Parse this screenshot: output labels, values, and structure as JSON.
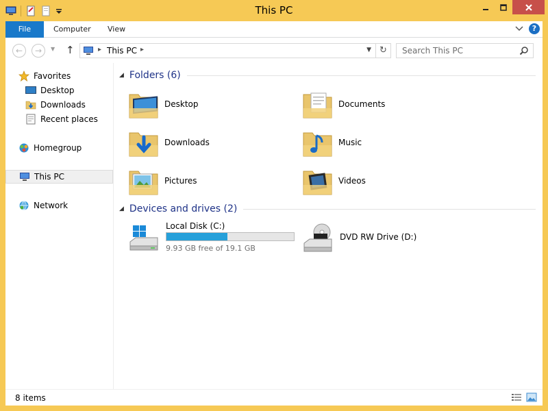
{
  "window": {
    "title": "This PC"
  },
  "ribbon": {
    "tabs": [
      {
        "label": "File"
      },
      {
        "label": "Computer"
      },
      {
        "label": "View"
      }
    ],
    "help_label": "?"
  },
  "address": {
    "crumb": "This PC",
    "search_placeholder": "Search This PC"
  },
  "nav": {
    "favorites": "Favorites",
    "desktop": "Desktop",
    "downloads": "Downloads",
    "recent": "Recent places",
    "homegroup": "Homegroup",
    "thispc": "This PC",
    "network": "Network"
  },
  "folders": {
    "header": "Folders (6)",
    "items": [
      {
        "label": "Desktop"
      },
      {
        "label": "Documents"
      },
      {
        "label": "Downloads"
      },
      {
        "label": "Music"
      },
      {
        "label": "Pictures"
      },
      {
        "label": "Videos"
      }
    ]
  },
  "drives": {
    "header": "Devices and drives (2)",
    "items": [
      {
        "name": "Local Disk (C:)",
        "free_text": "9.93 GB free of 19.1 GB",
        "used_fraction": 0.48
      },
      {
        "name": "DVD RW Drive (D:)"
      }
    ]
  },
  "status": {
    "count": "8 items"
  },
  "colors": {
    "accent": "#1979ca",
    "titlebar": "#f6c955",
    "close": "#c7504a",
    "drive_bar": "#26a0da",
    "group_title": "#1e3287"
  }
}
